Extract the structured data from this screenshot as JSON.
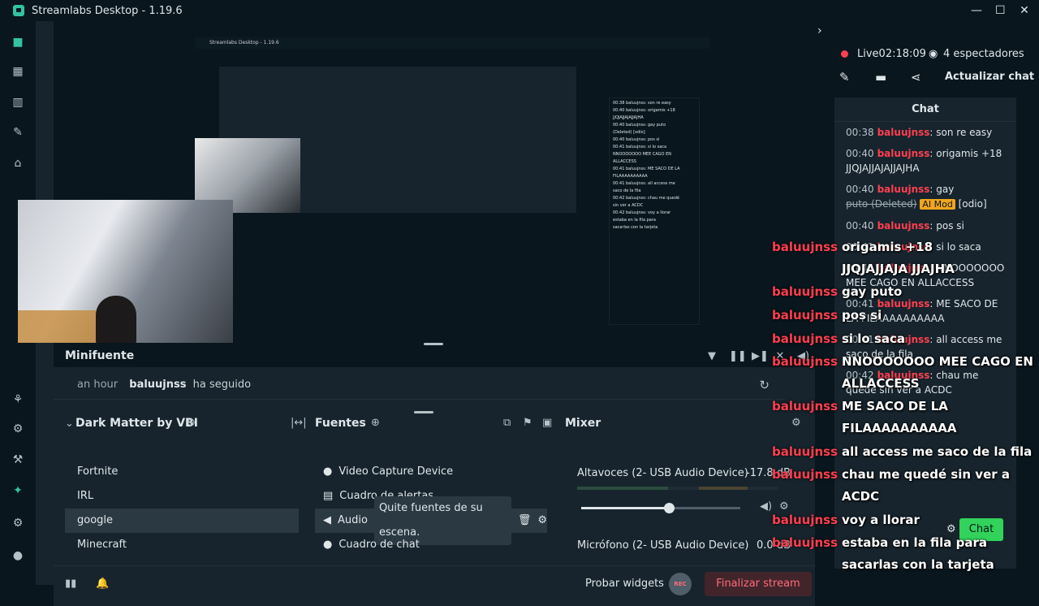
{
  "window": {
    "title": "Streamlabs Desktop - 1.19.6",
    "controls": [
      "—",
      "☐",
      "✕"
    ]
  },
  "nav": {
    "icons": [
      "editor-icon",
      "layout-icon",
      "stats-icon",
      "themes-icon",
      "store-icon",
      "apps-icon",
      "integrations-icon",
      "settings-icon",
      "user-icon"
    ]
  },
  "preview": {
    "nested": {
      "title": "Streamlabs Desktop - 1.19.6",
      "chat_lines": [
        "00:38 baluujnss: son re easy",
        "00:40 baluujnss: origamis +18",
        "JJQJAJJAJAJJAJHA",
        "00:40 baluujnss: gay puto",
        "(Deleted) [odio]",
        "00:40 baluujnss: pos si",
        "00:41 baluujnss: si lo saca",
        "NNOOOOOOO MEE CAGO EN",
        "ALLACCESS",
        "00:41 baluujnss: ME SACO DE LA",
        "FILAAAAAAAAAA",
        "00:41 baluujnss: all access me",
        "saco de la fila",
        "00:42 baluujnss: chau me quedé",
        "sin ver a ACDC",
        "00:42 baluujnss: voy a llorar",
        "estaba en la fila para",
        "sacarlas con la tarjeta"
      ]
    }
  },
  "minifuente": {
    "label": "Minifuente",
    "event": {
      "time": "an hour",
      "user": "baluujnss",
      "action": "ha seguido"
    }
  },
  "scenes": {
    "title": "Dark Matter by VBI",
    "items": [
      "Fortnite",
      "IRL",
      "google",
      "Minecraft"
    ],
    "selected_index": 2
  },
  "sources": {
    "title": "Fuentes",
    "items": [
      {
        "label": "Video Capture Device",
        "icon": "camera-icon"
      },
      {
        "label": "Cuadro de alertas",
        "icon": "alert-box-icon"
      },
      {
        "label": "Audio",
        "icon": "speaker-icon"
      },
      {
        "label": "Cuadro de chat",
        "icon": "chat-bubble-icon"
      }
    ],
    "tooltip": "Quite fuentes de su escena."
  },
  "mixer": {
    "title": "Mixer",
    "items": [
      {
        "label": "Altavoces (2- USB Audio Device)",
        "db": "-17.8 dB",
        "volume": 0.55
      },
      {
        "label": "Micrófono (2- USB Audio Device)",
        "db": "0.0 dB"
      }
    ]
  },
  "footer": {
    "test_widgets": "Probar widgets",
    "rec": "REC",
    "end_stream": "Finalizar stream"
  },
  "right": {
    "live_label": "Live",
    "live_time": "02:18:09",
    "viewers": "4 espectadores",
    "refresh_chat": "Actualizar chat",
    "chat_title": "Chat",
    "send_label": "Chat",
    "messages": [
      {
        "time": "00:38",
        "user": "baluujnss",
        "text": ": son re easy"
      },
      {
        "time": "00:40",
        "user": "baluujnss",
        "text": ": origamis +18 JJQJAJJAJAJJAJHA"
      },
      {
        "time": "00:40",
        "user": "baluujnss",
        "text": ": gay"
      },
      {
        "time": "00:40",
        "user": "baluujnss",
        "text": ": pos si"
      },
      {
        "time": "00:41",
        "user": "baluujnss",
        "text": ": si lo saca"
      },
      {
        "time": "00:41",
        "user": "baluujnss",
        "text": ": NNOOOOOOO MEE CAGO EN ALLACCESS"
      },
      {
        "time": "00:41",
        "user": "baluujnss",
        "text": ": ME SACO DE LA FILAAAAAAAAAA"
      },
      {
        "time": "00:41",
        "user": "baluujnss",
        "text": ": all access me saco de la fila"
      },
      {
        "time": "00:42",
        "user": "baluujnss",
        "text": ": chau me quedé sin ver a ACDC"
      }
    ],
    "deleted_text": "puto (Deleted)",
    "mod_badge": "AI Mod",
    "mod_tag": "[odio]"
  },
  "overlay": {
    "user": "baluujnss",
    "lines": [
      "origamis +18",
      "JJQJAJJAJA JJAJHA",
      "gay puto",
      "pos si",
      "si lo saca",
      "NNOOOOOOO MEE CAGO EN",
      "ALLACCESS",
      "ME SACO DE LA",
      "FILAAAAAAAAAA",
      "all access me saco de la fila",
      "chau me quedé sin ver a",
      "ACDC",
      "voy a llorar",
      "estaba en la fila para",
      "sacarlas con la tarjeta"
    ]
  },
  "colors": {
    "accent": "#31c3a2",
    "live": "#ff3f4f",
    "send": "#31d35a"
  }
}
